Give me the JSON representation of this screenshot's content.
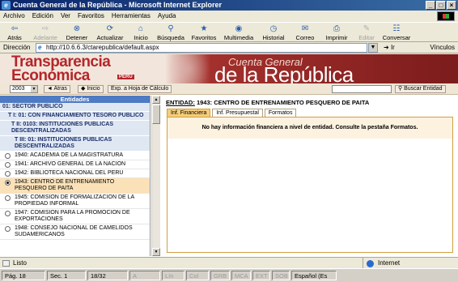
{
  "window": {
    "title": "Cuenta General de la República - Microsoft Internet Explorer"
  },
  "menu": [
    "Archivo",
    "Edición",
    "Ver",
    "Favoritos",
    "Herramientas",
    "Ayuda"
  ],
  "toolbar": [
    {
      "label": "Atrás",
      "icon": "back-arrow-icon",
      "glyph": "⇦",
      "enabled": true
    },
    {
      "label": "Adelante",
      "icon": "forward-arrow-icon",
      "glyph": "⇨",
      "enabled": false
    },
    {
      "label": "Detener",
      "icon": "stop-icon",
      "glyph": "⊗",
      "enabled": true
    },
    {
      "label": "Actualizar",
      "icon": "refresh-icon",
      "glyph": "⟳",
      "enabled": true
    },
    {
      "label": "Inicio",
      "icon": "home-icon",
      "glyph": "⌂",
      "enabled": true
    },
    {
      "label": "Búsqueda",
      "icon": "search-icon",
      "glyph": "⚲",
      "enabled": true
    },
    {
      "label": "Favoritos",
      "icon": "favorites-icon",
      "glyph": "★",
      "enabled": true
    },
    {
      "label": "Multimedia",
      "icon": "media-icon",
      "glyph": "◉",
      "enabled": true
    },
    {
      "label": "Historial",
      "icon": "history-icon",
      "glyph": "◷",
      "enabled": true
    },
    {
      "label": "Correo",
      "icon": "mail-icon",
      "glyph": "✉",
      "enabled": true
    },
    {
      "label": "Imprimir",
      "icon": "print-icon",
      "glyph": "⎙",
      "enabled": true
    },
    {
      "label": "Editar",
      "icon": "edit-icon",
      "glyph": "✎",
      "enabled": false
    },
    {
      "label": "Conversar",
      "icon": "discuss-icon",
      "glyph": "☷",
      "enabled": true
    }
  ],
  "address": {
    "label": "Dirección",
    "url": "http://10.6.6.3/ctarepublica/default.aspx",
    "go": "Ir",
    "links": "Vínculos"
  },
  "banner": {
    "line1": "Transparencia",
    "line2": "Económica",
    "peru": "PERÚ",
    "cuenta": "Cuenta General",
    "republica": "de la República"
  },
  "controls": {
    "year": "2003",
    "back": "Atras",
    "home": "Inicio",
    "export": "Exp. a Hoja de Cálculo",
    "search": "Buscar Entidad"
  },
  "tree": {
    "header": "Entidades",
    "sections": [
      {
        "text": "01: SECTOR PUBLICO",
        "level": 0
      },
      {
        "text": "T I: 01: CON FINANCIAMIENTO TESORO PUBLICO",
        "level": 1
      },
      {
        "text": "T II: 0103: INSTITUCIONES PUBLICAS DESCENTRALIZADAS",
        "level": 2
      },
      {
        "text": "T III: 01: INSTITUCIONES PUBLICAS DESCENTRALIZADAS",
        "level": 3
      }
    ],
    "entities": [
      {
        "text": "1940: ACADEMIA DE LA MAGISTRATURA",
        "selected": false
      },
      {
        "text": "1941: ARCHIVO GENERAL DE LA NACION",
        "selected": false
      },
      {
        "text": "1942: BIBLIOTECA NACIONAL DEL PERU",
        "selected": false
      },
      {
        "text": "1943: CENTRO DE ENTRENAMIENTO PESQUERO DE PAITA",
        "selected": true
      },
      {
        "text": "1945: COMISION DE FORMALIZACION DE LA PROPIEDAD INFORMAL",
        "selected": false
      },
      {
        "text": "1947: COMISION PARA LA PROMOCION DE EXPORTACIONES",
        "selected": false
      },
      {
        "text": "1948: CONSEJO NACIONAL DE CAMELIDOS SUDAMERICANOS",
        "selected": false
      }
    ]
  },
  "content": {
    "entidad_label": "ENTIDAD:",
    "entidad_name": "1943: CENTRO DE ENTRENAMIENTO PESQUERO DE PAITA",
    "tabs": [
      "Inf. Financiera",
      "Inf. Presupuestal",
      "Formatos"
    ],
    "message": "No hay información financiera a nivel de entidad. Consulte la pestaña Formatos."
  },
  "status": {
    "text": "Listo",
    "zone": "Internet"
  },
  "taskbar": {
    "page": "Pág. 18",
    "sec": "Sec. 1",
    "pos": "18/32",
    "at": "A",
    "line": "Lín",
    "col": "Col",
    "grb": "GRB",
    "mca": "MCA",
    "ext": "EXT",
    "sob": "SOB",
    "lang": "Español (Es"
  }
}
